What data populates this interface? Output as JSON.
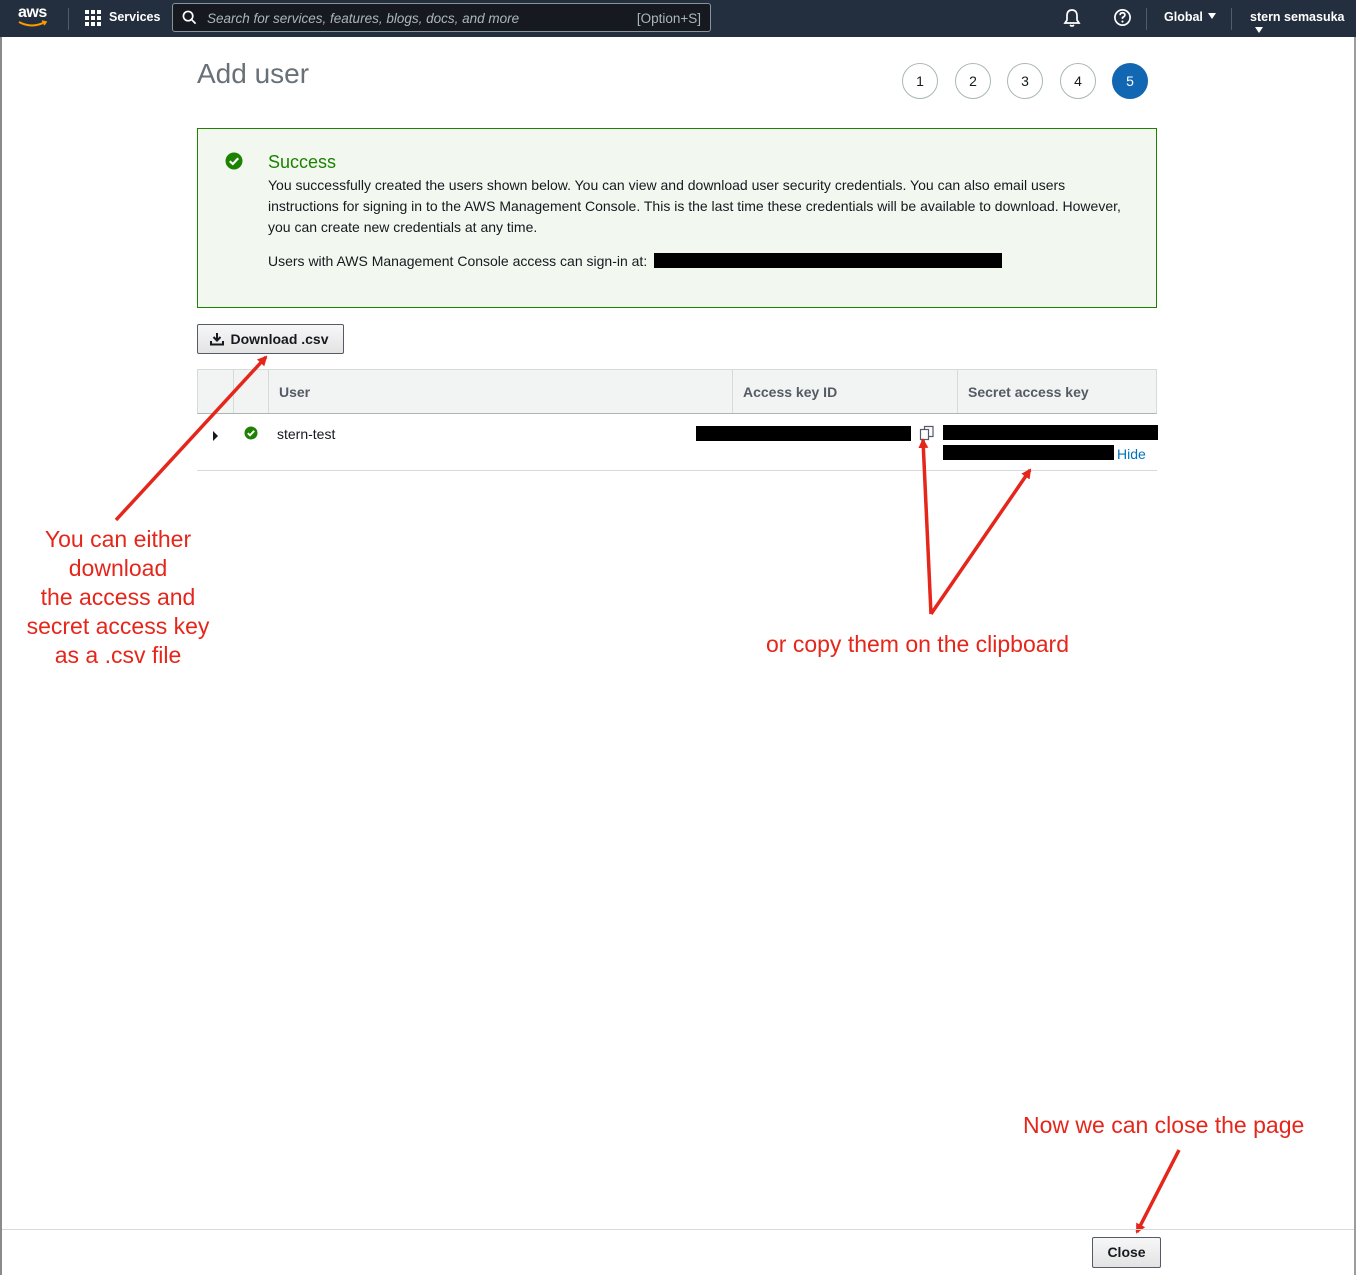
{
  "nav": {
    "logo_text": "aws",
    "services_label": "Services",
    "search_placeholder": "Search for services, features, blogs, docs, and more",
    "search_shortcut": "[Option+S]",
    "region_label": "Global",
    "account_label": "stern semasuka"
  },
  "page": {
    "title": "Add user",
    "steps": [
      "1",
      "2",
      "3",
      "4",
      "5"
    ],
    "active_step": "5"
  },
  "alert": {
    "title": "Success",
    "message": "You successfully created the users shown below. You can view and download user security credentials. You can also email users instructions for signing in to the AWS Management Console. This is the last time these credentials will be available to download. However, you can create new credentials at any time.",
    "signin_text": "Users with AWS Management Console access can sign-in at:"
  },
  "download_button": "Download .csv",
  "table": {
    "headers": [
      "User",
      "Access key ID",
      "Secret access key"
    ],
    "rows": [
      {
        "user": "stern-test",
        "hide_label": "Hide"
      }
    ]
  },
  "annotations": {
    "left": [
      "You can either",
      "download",
      "the access and",
      "secret access key",
      "as a .csv file"
    ],
    "middle": "or copy them on the clipboard",
    "close": "Now we can close the page"
  },
  "footer": {
    "close_button": "Close"
  },
  "colors": {
    "nav_bg": "#232f3e",
    "success_green": "#1d8102",
    "active_step_blue": "#1167b1",
    "link_blue": "#0073bb",
    "annotation_red": "#e5261b"
  }
}
